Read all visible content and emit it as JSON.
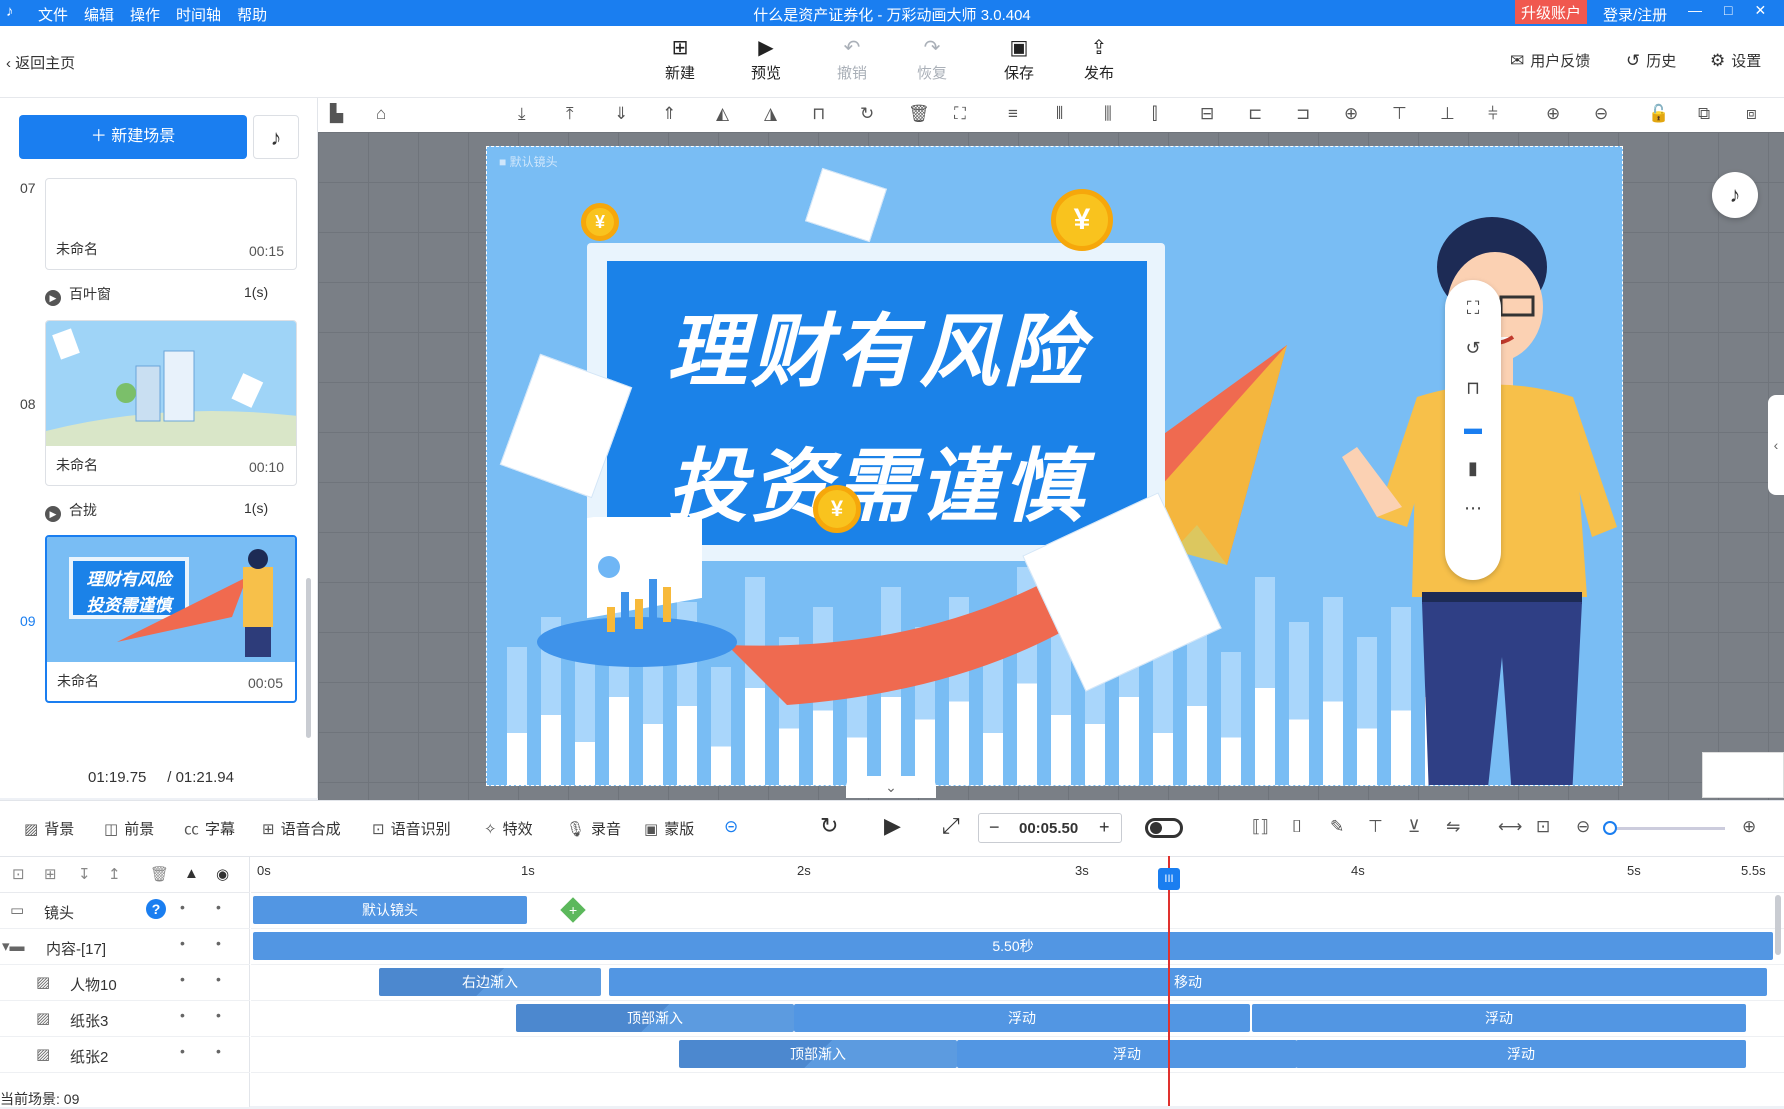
{
  "app": {
    "title": "什么是资产证券化 - 万彩动画大师 3.0.404",
    "menu": [
      "文件",
      "编辑",
      "操作",
      "时间轴",
      "帮助"
    ],
    "upgrade": "升级账户",
    "login": "登录/注册",
    "win_min": "—",
    "win_max": "□",
    "win_close": "✕"
  },
  "toolbar": {
    "back": "返回主页",
    "new": "新建",
    "preview": "预览",
    "undo": "撤销",
    "redo": "恢复",
    "save": "保存",
    "publish": "发布",
    "feedback": "用户反馈",
    "history": "历史",
    "settings": "设置"
  },
  "scenes": {
    "new_scene": "新建场景",
    "items": [
      {
        "num": "07",
        "name": "未命名",
        "time": "00:15"
      },
      {
        "num": "08",
        "name": "未命名",
        "time": "00:10"
      },
      {
        "num": "09",
        "name": "未命名",
        "time": "00:05"
      }
    ],
    "transitions": [
      {
        "name": "百叶窗",
        "dur": "1(s)"
      },
      {
        "name": "合拢",
        "dur": "1(s)"
      }
    ],
    "thumb09_line1": "理财有风险",
    "thumb09_line2": "投资需谨慎",
    "time_current": "01:19.75",
    "time_total": "/ 01:21.94"
  },
  "stage": {
    "camera_label": "默认镜头",
    "line1": "理财有风险",
    "line2": "投资需谨慎",
    "coin": "¥",
    "bars": [
      120,
      160,
      100,
      200,
      140,
      180,
      90,
      220,
      130,
      170,
      110,
      200,
      150,
      190,
      120,
      230,
      160,
      140,
      200,
      120,
      180,
      110,
      220,
      150,
      190,
      130,
      170,
      200
    ],
    "bars_light": [
      80,
      110,
      70,
      140,
      95,
      125,
      60,
      150,
      90,
      120,
      75,
      140,
      100,
      130,
      85,
      160,
      110,
      95,
      140,
      80,
      125,
      75,
      150,
      105,
      130,
      90,
      120,
      140
    ]
  },
  "timeline_bar": {
    "bg": "背景",
    "fg": "前景",
    "subtitle": "字幕",
    "tts": "语音合成",
    "asr": "语音识别",
    "effects": "特效",
    "record": "录音",
    "mask": "蒙版",
    "time": "00:05.50",
    "minus": "−",
    "plus": "+"
  },
  "timeline": {
    "ruler": [
      "0s",
      "1s",
      "2s",
      "3s",
      "4s",
      "5s",
      "5.5s"
    ],
    "rows": [
      {
        "name": "镜头",
        "clips": [
          {
            "label": "默认镜头"
          }
        ]
      },
      {
        "name": "内容-[17]",
        "clips": [
          {
            "label": "5.50秒"
          }
        ]
      },
      {
        "name": "人物10",
        "clips": [
          {
            "label": "右边渐入"
          },
          {
            "label": "移动"
          }
        ]
      },
      {
        "name": "纸张3",
        "clips": [
          {
            "label": "顶部渐入"
          },
          {
            "label": "浮动"
          },
          {
            "label": "浮动"
          }
        ]
      },
      {
        "name": "纸张2",
        "clips": [
          {
            "label": "顶部渐入"
          },
          {
            "label": "浮动"
          },
          {
            "label": "浮动"
          }
        ]
      }
    ],
    "current_scene": "当前场景: 09",
    "playhead_label": "III"
  },
  "colors": {
    "primary": "#1a7ef0",
    "upgrade": "#f0584f",
    "playhead": "#e0312e"
  }
}
